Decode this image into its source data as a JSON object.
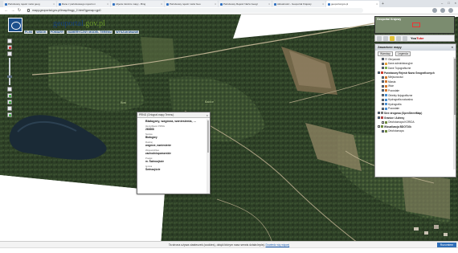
{
  "browser": {
    "tabs": [
      {
        "label": "Państwowy rejestr nazw geog",
        "active": false
      },
      {
        "label": "Dane z państwowego rejestru n",
        "active": false
      },
      {
        "label": "zdjecie lotnicze mapy - Bing",
        "active": false
      },
      {
        "label": "Państwowy rejestr nazw Geo",
        "active": false
      },
      {
        "label": "Państwowy Rejestr Nazw Geogr",
        "active": false
      },
      {
        "label": "Aktualności - Geoportal Krajowy",
        "active": false
      },
      {
        "label": "geoportal.gov.pl",
        "active": true
      }
    ],
    "url": "mapy.geoportal.gov.pl/imap/Imgp_2.html?gpmap=gp0"
  },
  "header": {
    "logo_text": "geoportal",
    "logo_domain": ".gov.pl",
    "menu": [
      "PLIKI",
      "WIDOK",
      "POMIARY",
      "NUMERYCZNY MODEL TERENU",
      "WYSZUKIWANIE"
    ]
  },
  "map_labels": {
    "left": "Bład",
    "mid": "Babice"
  },
  "minimap": {
    "title": "Geoportal Krajowy"
  },
  "right_toolbar": {
    "youtube": "You",
    "youtube_b": "Tube"
  },
  "layers": {
    "title": "Zawartość mapy",
    "tabs": [
      "Warstwy",
      "Legenda"
    ],
    "rows": [
      {
        "label": "Obrysówki",
        "group": false,
        "on": true,
        "color": "#c9c9c9"
      },
      {
        "label": "Dane administracyjne",
        "group": false,
        "on": true,
        "color": "#e5a23b"
      },
      {
        "label": "Dane Topograficzne",
        "group": false,
        "on": true,
        "color": "#7fb04f"
      },
      {
        "label": "Państwowy Rejestr Nazw Geograficznych",
        "group": true,
        "on": true,
        "color": "#cc3b2e"
      },
      {
        "label": "Miejscowości",
        "group": false,
        "on": true,
        "color": "#d57a2e"
      },
      {
        "label": "Miasta",
        "group": false,
        "on": true,
        "color": "#d57a2e"
      },
      {
        "label": "Wsie",
        "group": false,
        "on": true,
        "color": "#d57a2e"
      },
      {
        "label": "Pozostałe",
        "group": false,
        "on": true,
        "color": "#d57a2e"
      },
      {
        "label": "Obiekty fizjograficzne",
        "group": false,
        "on": true,
        "color": "#4a8fd1"
      },
      {
        "label": "Hydrografia naturalna",
        "group": false,
        "on": true,
        "color": "#4a8fd1"
      },
      {
        "label": "Hydrografia",
        "group": false,
        "on": true,
        "color": "#4a8fd1"
      },
      {
        "label": "Pozostałe",
        "group": false,
        "on": true,
        "color": "#4a8fd1"
      },
      {
        "label": "Sieć drogowa (OpenStreetMap)",
        "group": true,
        "on": true,
        "color": "#777777"
      },
      {
        "label": "Granice i Adresy",
        "group": true,
        "on": true,
        "color": "#b04444"
      },
      {
        "label": "Ortofotomapa KORIDA",
        "group": false,
        "on": false,
        "color": "#6f8a3f"
      },
      {
        "label": "Wizualizacja BDOT10k",
        "group": true,
        "on": false,
        "color": "#6f8a3f"
      },
      {
        "label": "Ortofotomapa",
        "group": false,
        "on": true,
        "color": "#6f8a3f"
      }
    ]
  },
  "popup": {
    "header": "PRNG (Ortograf-mapy Terenu)",
    "title": "Białogóry, wzgórza, wzniesienia, ...",
    "fields": [
      {
        "k": "Identyfikator PRNG",
        "v": "263868"
      },
      {
        "k": "Nazwa",
        "v": "Białogóry"
      },
      {
        "k": "Rodzaj",
        "v": "wzgórze, wzniesienie"
      },
      {
        "k": "Województwo",
        "v": "zachodniopomorskie"
      },
      {
        "k": "Powiat",
        "v": "m. Świnoujście"
      },
      {
        "k": "Gmina",
        "v": "Świnoujście"
      }
    ]
  },
  "cookie": {
    "text": "Ta strona używa ciasteczek (cookies), dzięki którym nasz serwis działa lepiej.",
    "link": "Dowiedz się więcej",
    "button": "Rozumiem"
  }
}
